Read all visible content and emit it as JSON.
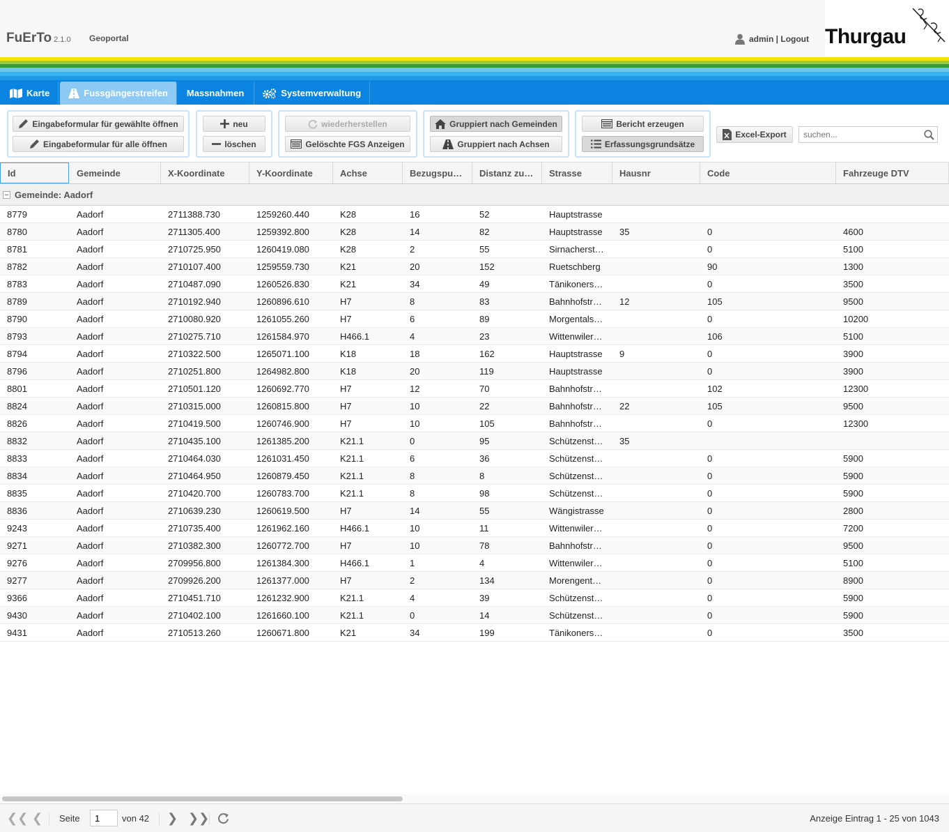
{
  "header": {
    "app_name": "FuErTo",
    "version": "2.1.0",
    "geoportal": "Geoportal",
    "user": "admin | Logout",
    "logo_text": "Thurgau"
  },
  "colors": {
    "nav_blue": "#0a84e0",
    "active_tab": "#8ec9f4",
    "stripes": [
      "#f2e400",
      "#9ec93a",
      "#3a9a3a",
      "#6cc7ee",
      "#34b4f0",
      "#1e9be8"
    ]
  },
  "nav": {
    "tabs": [
      {
        "label": "Karte",
        "icon": "map-icon"
      },
      {
        "label": "Fussgängerstreifen",
        "icon": "road-icon"
      },
      {
        "label": "Massnahmen",
        "icon": ""
      },
      {
        "label": "Systemverwaltung",
        "icon": "gears-icon"
      }
    ]
  },
  "toolbar": {
    "open_selected": "Eingabeformular für gewählte öffnen",
    "open_all": "Eingabeformular für alle öffnen",
    "new": "neu",
    "delete": "löschen",
    "restore": "wiederherstellen",
    "show_deleted": "Gelöschte FGS Anzeigen",
    "group_municipalities": "Gruppiert nach Gemeinden",
    "group_axes": "Gruppiert nach Achsen",
    "report": "Bericht erzeugen",
    "principles": "Erfassungsgrundsätze",
    "excel": "Excel-Export",
    "search_placeholder": "suchen..."
  },
  "grid": {
    "columns": [
      "Id",
      "Gemeinde",
      "X-Koordinate",
      "Y-Koordinate",
      "Achse",
      "Bezugspu…",
      "Distanz zu…",
      "Strasse",
      "Hausnr",
      "Code",
      "Fahrzeuge DTV"
    ],
    "group_label": "Gemeinde: Aadorf",
    "rows": [
      [
        "8779",
        "Aadorf",
        "2711388.730",
        "1259260.440",
        "K28",
        "16",
        "52",
        "Hauptstrasse",
        "",
        "",
        ""
      ],
      [
        "8780",
        "Aadorf",
        "2711305.400",
        "1259392.800",
        "K28",
        "14",
        "82",
        "Hauptstrasse",
        "35",
        "0",
        "4600"
      ],
      [
        "8781",
        "Aadorf",
        "2710725.950",
        "1260419.080",
        "K28",
        "2",
        "55",
        "Sirnacherst…",
        "",
        "0",
        "5100"
      ],
      [
        "8782",
        "Aadorf",
        "2710107.400",
        "1259559.730",
        "K21",
        "20",
        "152",
        "Ruetschberg",
        "",
        "90",
        "1300"
      ],
      [
        "8783",
        "Aadorf",
        "2710487.090",
        "1260526.830",
        "K21",
        "34",
        "49",
        "Tänikoners…",
        "",
        "0",
        "3500"
      ],
      [
        "8789",
        "Aadorf",
        "2710192.940",
        "1260896.610",
        "H7",
        "8",
        "83",
        "Bahnhofstr…",
        "12",
        "105",
        "9500"
      ],
      [
        "8790",
        "Aadorf",
        "2710080.920",
        "1261055.260",
        "H7",
        "6",
        "89",
        "Morgentals…",
        "",
        "0",
        "10200"
      ],
      [
        "8793",
        "Aadorf",
        "2710275.710",
        "1261584.970",
        "H466.1",
        "4",
        "23",
        "Wittenwiler…",
        "",
        "106",
        "5100"
      ],
      [
        "8794",
        "Aadorf",
        "2710322.500",
        "1265071.100",
        "K18",
        "18",
        "162",
        "Hauptstrasse",
        "9",
        "0",
        "3900"
      ],
      [
        "8796",
        "Aadorf",
        "2710251.800",
        "1264982.800",
        "K18",
        "20",
        "119",
        "Hauptstrasse",
        "",
        "0",
        "3900"
      ],
      [
        "8801",
        "Aadorf",
        "2710501.120",
        "1260692.770",
        "H7",
        "12",
        "70",
        "Bahnhofstr…",
        "",
        "102",
        "12300"
      ],
      [
        "8824",
        "Aadorf",
        "2710315.000",
        "1260815.800",
        "H7",
        "10",
        "22",
        "Bahnhofstr…",
        "22",
        "105",
        "9500"
      ],
      [
        "8826",
        "Aadorf",
        "2710419.500",
        "1260746.900",
        "H7",
        "10",
        "105",
        "Bahnhofstr…",
        "",
        "0",
        "12300"
      ],
      [
        "8832",
        "Aadorf",
        "2710435.100",
        "1261385.200",
        "K21.1",
        "0",
        "95",
        "Schützenst…",
        "35",
        "",
        ""
      ],
      [
        "8833",
        "Aadorf",
        "2710464.030",
        "1261031.450",
        "K21.1",
        "6",
        "36",
        "Schützenst…",
        "",
        "0",
        "5900"
      ],
      [
        "8834",
        "Aadorf",
        "2710464.950",
        "1260879.450",
        "K21.1",
        "8",
        "8",
        "Schützenst…",
        "",
        "0",
        "5900"
      ],
      [
        "8835",
        "Aadorf",
        "2710420.700",
        "1260783.700",
        "K21.1",
        "8",
        "98",
        "Schützenst…",
        "",
        "0",
        "5900"
      ],
      [
        "8836",
        "Aadorf",
        "2710639.230",
        "1260619.500",
        "H7",
        "14",
        "55",
        "Wängistrasse",
        "",
        "0",
        "2800"
      ],
      [
        "9243",
        "Aadorf",
        "2710735.400",
        "1261962.160",
        "H466.1",
        "10",
        "11",
        "Wittenwiler…",
        "",
        "0",
        "7200"
      ],
      [
        "9271",
        "Aadorf",
        "2710382.300",
        "1260772.700",
        "H7",
        "10",
        "78",
        "Bahnhofstr…",
        "",
        "0",
        "9500"
      ],
      [
        "9276",
        "Aadorf",
        "2709956.800",
        "1261384.300",
        "H466.1",
        "1",
        "4",
        "Wittenwiler…",
        "",
        "0",
        "5100"
      ],
      [
        "9277",
        "Aadorf",
        "2709926.200",
        "1261377.000",
        "H7",
        "2",
        "134",
        "Morengent…",
        "",
        "0",
        "8900"
      ],
      [
        "9366",
        "Aadorf",
        "2710451.710",
        "1261232.900",
        "K21.1",
        "4",
        "39",
        "Schützenst…",
        "",
        "0",
        "5900"
      ],
      [
        "9430",
        "Aadorf",
        "2710402.100",
        "1261660.100",
        "K21.1",
        "0",
        "14",
        "Schützenst…",
        "",
        "0",
        "5900"
      ],
      [
        "9431",
        "Aadorf",
        "2710513.260",
        "1260671.800",
        "K21",
        "34",
        "199",
        "Tänikoners…",
        "",
        "0",
        "3500"
      ]
    ]
  },
  "pager": {
    "page_label": "Seite",
    "page_value": "1",
    "of_label": "von 42",
    "summary": "Anzeige Eintrag 1 - 25 von 1043"
  }
}
